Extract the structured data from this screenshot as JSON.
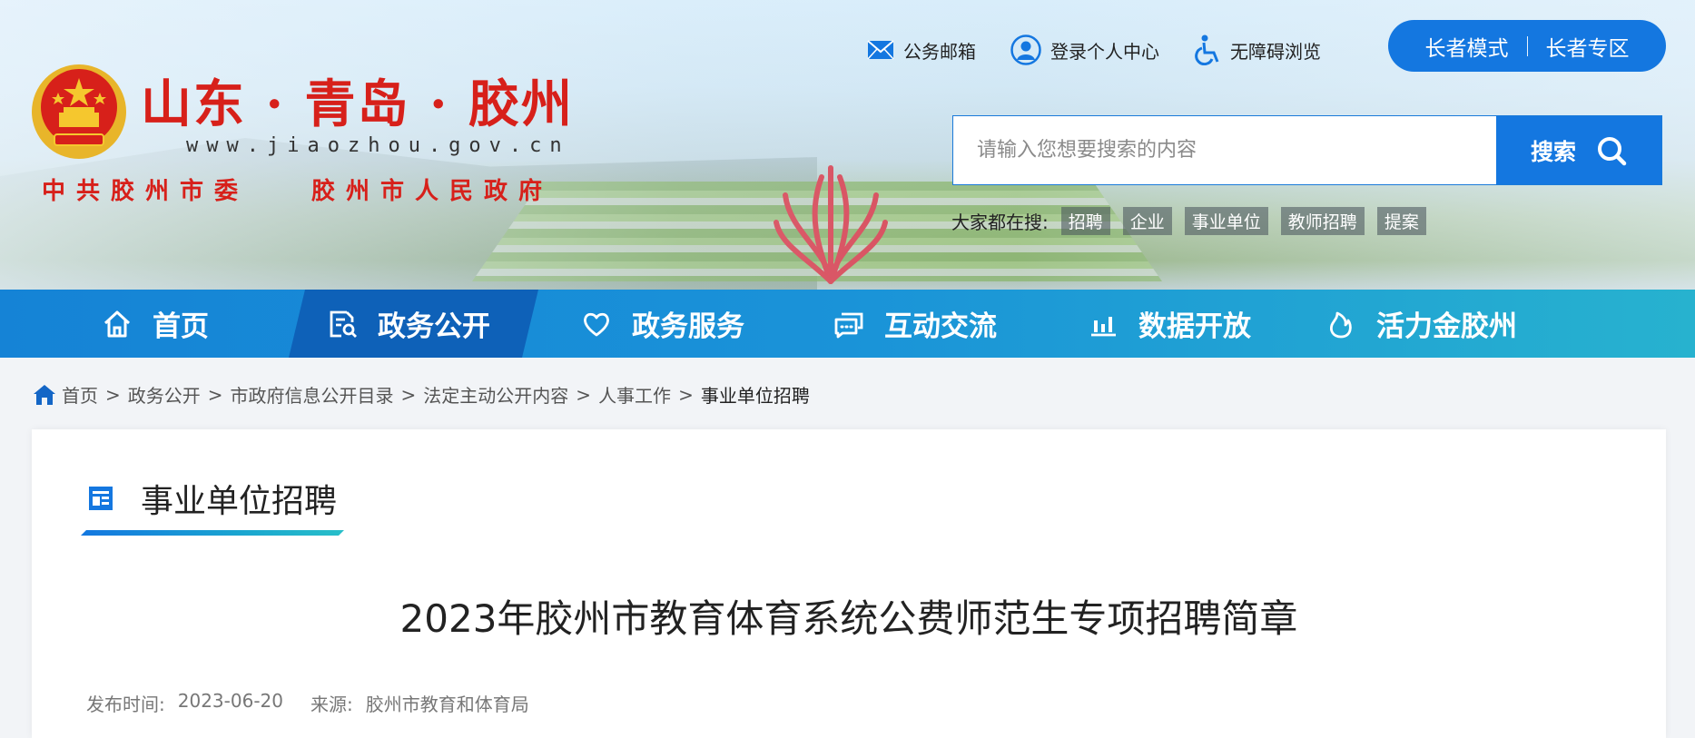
{
  "header": {
    "site_title": "山东 · 青岛 · 胶州",
    "domain": "www.jiaozhou.gov.cn",
    "org_left": "中共胶州市委",
    "org_right": "胶州市人民政府",
    "links": {
      "mail": "公务邮箱",
      "login": "登录个人中心",
      "accessible": "无障碍浏览"
    },
    "elder": {
      "mode": "长者模式",
      "zone": "长者专区"
    },
    "search": {
      "placeholder": "请输入您想要搜索的内容",
      "button": "搜索"
    },
    "hot": {
      "label": "大家都在搜:",
      "tags": [
        "招聘",
        "企业",
        "事业单位",
        "教师招聘",
        "提案"
      ]
    }
  },
  "nav": {
    "items": [
      {
        "label": "首页",
        "icon": "home-icon"
      },
      {
        "label": "政务公开",
        "icon": "document-search-icon",
        "active": true
      },
      {
        "label": "政务服务",
        "icon": "heart-icon"
      },
      {
        "label": "互动交流",
        "icon": "chat-icon"
      },
      {
        "label": "数据开放",
        "icon": "bar-chart-icon"
      },
      {
        "label": "活力金胶州",
        "icon": "flame-icon"
      }
    ]
  },
  "breadcrumb": [
    "首页",
    "政务公开",
    "市政府信息公开目录",
    "法定主动公开内容",
    "人事工作",
    "事业单位招聘"
  ],
  "breadcrumb_sep": ">",
  "content": {
    "section_title": "事业单位招聘",
    "article_title": "2023年胶州市教育体育系统公费师范生专项招聘简章",
    "meta": {
      "date_label": "发布时间:",
      "date": "2023-06-20",
      "source_label": "来源:",
      "source": "胶州市教育和体育局"
    }
  },
  "colors": {
    "primary": "#1477e0",
    "title_red": "#d7201a",
    "nav_active": "#0e61b8"
  }
}
